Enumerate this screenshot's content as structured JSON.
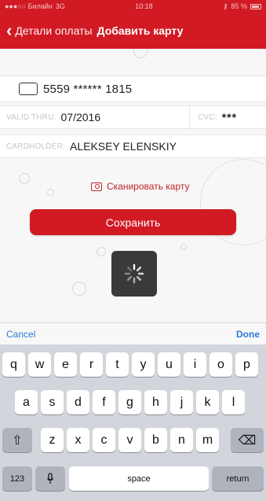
{
  "status_bar": {
    "carrier": "●●●○○ Билайн",
    "network": "3G",
    "time": "10:18",
    "battery": "85 %"
  },
  "nav": {
    "back_label": "Детали оплаты",
    "title": "Добавить карту"
  },
  "form": {
    "card_number": "5559 ****** 1815",
    "valid_thru_label": "VALID THRU:",
    "valid_thru_value": "07/2016",
    "cvc_label": "CVC:",
    "cvc_value": "***",
    "cardholder_label": "CARDHOLDER:",
    "cardholder_value": "ALEKSEY ELENSKIY"
  },
  "scan_label": "Сканировать карту",
  "save_label": "Сохранить",
  "accessory": {
    "cancel": "Cancel",
    "done": "Done"
  },
  "keyboard": {
    "row1": [
      "q",
      "w",
      "e",
      "r",
      "t",
      "y",
      "u",
      "i",
      "o",
      "p"
    ],
    "row2": [
      "a",
      "s",
      "d",
      "f",
      "g",
      "h",
      "j",
      "k",
      "l"
    ],
    "row3": [
      "z",
      "x",
      "c",
      "v",
      "b",
      "n",
      "m"
    ],
    "numbers_key": "123",
    "space_key": "space",
    "return_key": "return"
  },
  "colors": {
    "brand_red": "#d11a24",
    "link_blue": "#2d7bd6"
  }
}
